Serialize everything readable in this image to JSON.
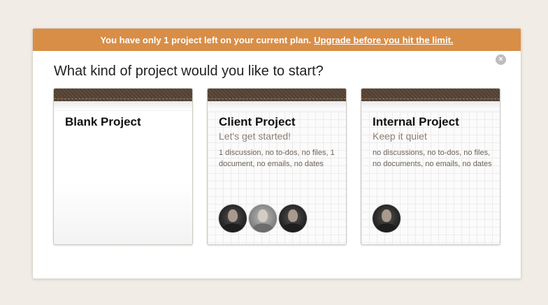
{
  "banner": {
    "message": "You have only 1 project left on your current plan.",
    "link": "Upgrade before you hit the limit.",
    "color": "#d98e47"
  },
  "close": {
    "icon": "close-icon",
    "glyph": "×"
  },
  "heading": "What kind of project would you like to start?",
  "cards": [
    {
      "title": "Blank Project",
      "subtitle": "",
      "description": ""
    },
    {
      "title": "Client Project",
      "subtitle": "Let's get started!",
      "description": "1 discussion, no to-dos, no files, 1 document, no emails, no dates"
    },
    {
      "title": "Internal Project",
      "subtitle": "Keep it quiet",
      "description": "no discussions, no to-dos, no files, no documents, no emails, no dates"
    }
  ]
}
